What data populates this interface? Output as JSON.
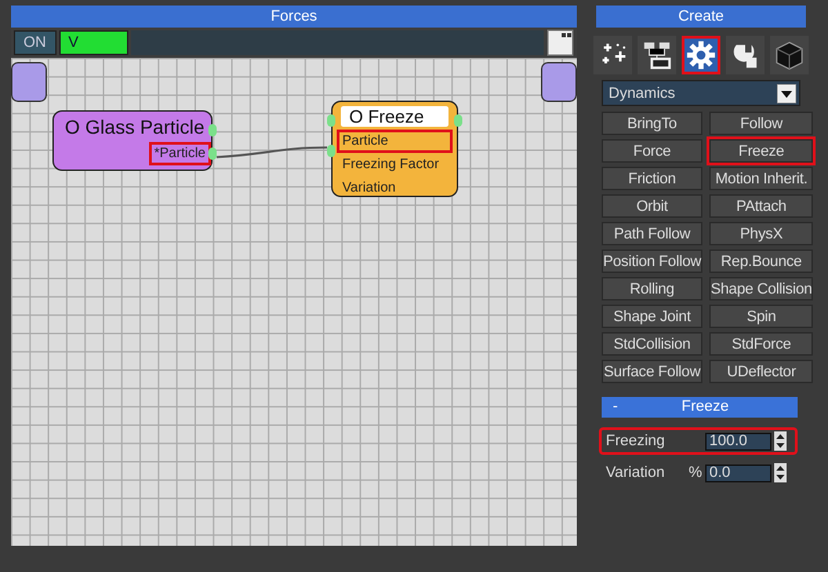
{
  "editor": {
    "title": "Forces",
    "toolbar": [
      {
        "label": "ON",
        "kind": "dark"
      },
      {
        "label": "V",
        "kind": "green"
      }
    ],
    "nodes": [
      {
        "title": "O Glass Particle",
        "kind": "object",
        "ports": [
          {
            "label": "*Particle",
            "highlighted": true
          }
        ]
      },
      {
        "title": "O Freeze",
        "kind": "operator",
        "ports": [
          {
            "label": "Particle",
            "highlighted": true
          },
          {
            "label": "Freezing Factor",
            "highlighted": false
          },
          {
            "label": "Variation",
            "highlighted": false
          }
        ]
      }
    ]
  },
  "create_panel": {
    "title": "Create",
    "tabs": [
      {
        "kind": "sparkle",
        "selected": false,
        "highlighted": false
      },
      {
        "kind": "list",
        "selected": false,
        "highlighted": false
      },
      {
        "kind": "gear",
        "selected": true,
        "highlighted": true
      },
      {
        "kind": "wrench",
        "selected": false,
        "highlighted": false
      },
      {
        "kind": "cube",
        "selected": false,
        "highlighted": false
      }
    ],
    "dropdown": {
      "value": "Dynamics"
    },
    "buttons": [
      {
        "label": "BringTo",
        "highlighted": false
      },
      {
        "label": "Follow",
        "highlighted": false
      },
      {
        "label": "Force",
        "highlighted": false
      },
      {
        "label": "Freeze",
        "highlighted": true
      },
      {
        "label": "Friction",
        "highlighted": false
      },
      {
        "label": "Motion Inherit.",
        "highlighted": false
      },
      {
        "label": "Orbit",
        "highlighted": false
      },
      {
        "label": "PAttach",
        "highlighted": false
      },
      {
        "label": "Path Follow",
        "highlighted": false
      },
      {
        "label": "PhysX",
        "highlighted": false
      },
      {
        "label": "Position Follow",
        "highlighted": false
      },
      {
        "label": "Rep.Bounce",
        "highlighted": false
      },
      {
        "label": "Rolling",
        "highlighted": false
      },
      {
        "label": "Shape Collision",
        "highlighted": false
      },
      {
        "label": "Shape Joint",
        "highlighted": false
      },
      {
        "label": "Spin",
        "highlighted": false
      },
      {
        "label": "StdCollision",
        "highlighted": false
      },
      {
        "label": "StdForce",
        "highlighted": false
      },
      {
        "label": "Surface Follow",
        "highlighted": false
      },
      {
        "label": "UDeflector",
        "highlighted": false
      }
    ]
  },
  "rollout": {
    "title": "Freeze",
    "collapse": "-",
    "params": [
      {
        "label": "Freezing",
        "value": "100.0",
        "highlighted": true
      },
      {
        "label": "Variation",
        "unit": "%",
        "value": "0.0",
        "highlighted": false
      }
    ]
  }
}
